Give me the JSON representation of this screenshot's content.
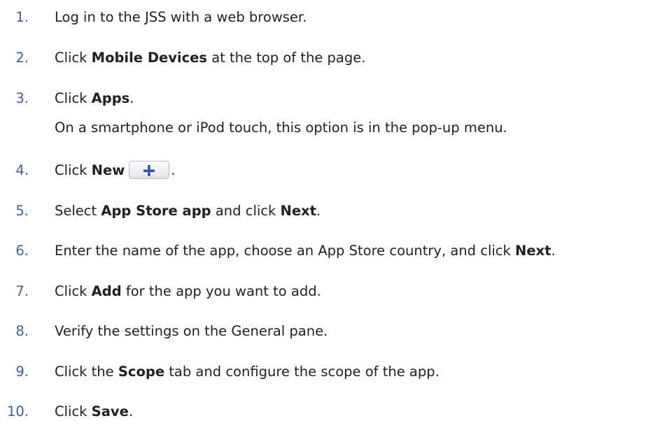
{
  "steps": [
    {
      "num": "1.",
      "parts": [
        {
          "t": "Log in to the JSS with a web browser."
        }
      ]
    },
    {
      "num": "2.",
      "parts": [
        {
          "t": "Click "
        },
        {
          "b": "Mobile Devices"
        },
        {
          "t": " at the top of the page."
        }
      ]
    },
    {
      "num": "3.",
      "parts": [
        {
          "t": "Click "
        },
        {
          "b": "Apps"
        },
        {
          "t": "."
        }
      ],
      "note": "On a smartphone or iPod touch, this option is in the pop-up menu."
    },
    {
      "num": "4.",
      "parts": [
        {
          "t": "Click "
        },
        {
          "b": "New"
        },
        {
          "icon": "plus-icon"
        },
        {
          "t": "."
        }
      ]
    },
    {
      "num": "5.",
      "parts": [
        {
          "t": "Select "
        },
        {
          "b": "App Store app"
        },
        {
          "t": " and click "
        },
        {
          "b": "Next"
        },
        {
          "t": "."
        }
      ]
    },
    {
      "num": "6.",
      "parts": [
        {
          "t": "Enter the name of the app, choose an App Store country, and click "
        },
        {
          "b": "Next"
        },
        {
          "t": "."
        }
      ]
    },
    {
      "num": "7.",
      "parts": [
        {
          "t": "Click "
        },
        {
          "b": "Add"
        },
        {
          "t": " for the app you want to add."
        }
      ]
    },
    {
      "num": "8.",
      "parts": [
        {
          "t": "Verify the settings on the General pane."
        }
      ]
    },
    {
      "num": "9.",
      "parts": [
        {
          "t": "Click the "
        },
        {
          "b": "Scope"
        },
        {
          "t": " tab and configure the scope of the app."
        }
      ]
    },
    {
      "num": "10.",
      "parts": [
        {
          "t": "Click "
        },
        {
          "b": "Save"
        },
        {
          "t": "."
        }
      ]
    }
  ],
  "colors": {
    "number": "#3d5f9c",
    "text": "#231f20",
    "plus_icon": "#2f57a4"
  }
}
